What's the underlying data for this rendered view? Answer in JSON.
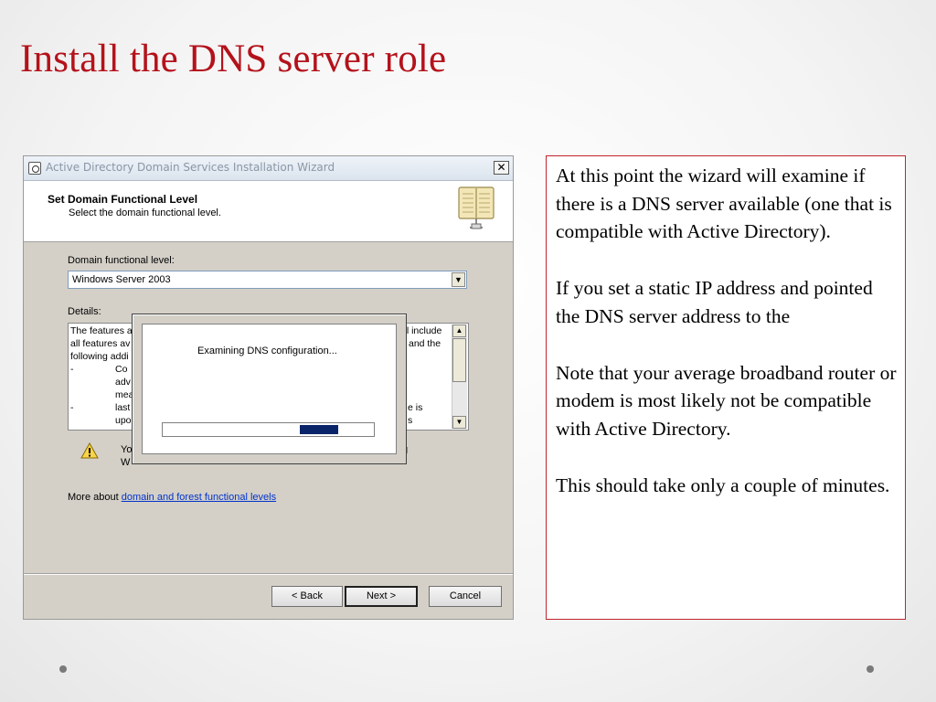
{
  "slide": {
    "title": "Install the DNS server role",
    "accent_color": "#b4121b"
  },
  "dialog": {
    "window_title": "Active Directory Domain Services Installation Wizard",
    "close_glyph": "✕",
    "header_title": "Set Domain Functional Level",
    "header_subtitle": "Select the domain functional level.",
    "header_icon": "book-icon",
    "functional_level_label": "Domain functional level:",
    "functional_level_value": "Windows Server 2003",
    "details_label": "Details:",
    "details_left": [
      "The features a",
      "all features av",
      "following addi",
      "  -",
      "",
      "",
      "  -",
      ""
    ],
    "details_indent": [
      "",
      "",
      "",
      "Co",
      "adv",
      "mea",
      "last",
      "upo"
    ],
    "details_right": [
      "el include",
      "and the",
      "",
      "",
      "",
      "",
      "e is",
      "s"
    ],
    "warning_icon": "warning-icon",
    "warning_text": [
      "Yo",
      "W"
    ],
    "warning_text_right": "g",
    "more_about_prefix": "More about ",
    "more_about_link": "domain and forest functional levels",
    "back_button": "< Back",
    "next_button": "Next >",
    "cancel_button": "Cancel"
  },
  "progress_popup": {
    "message": "Examining DNS configuration...",
    "marquee_color": "#0a246a"
  },
  "notes": {
    "paragraphs": [
      "At this point the wizard will examine if there is a DNS server available (one that is compatible with Active Directory).",
      "If you set a static IP address and pointed the DNS server address to the",
      "Note that your average broadband router or modem is most likely not be compatible with Active Directory.",
      "This should take only a couple of minutes."
    ],
    "border_color": "#c0242c"
  }
}
